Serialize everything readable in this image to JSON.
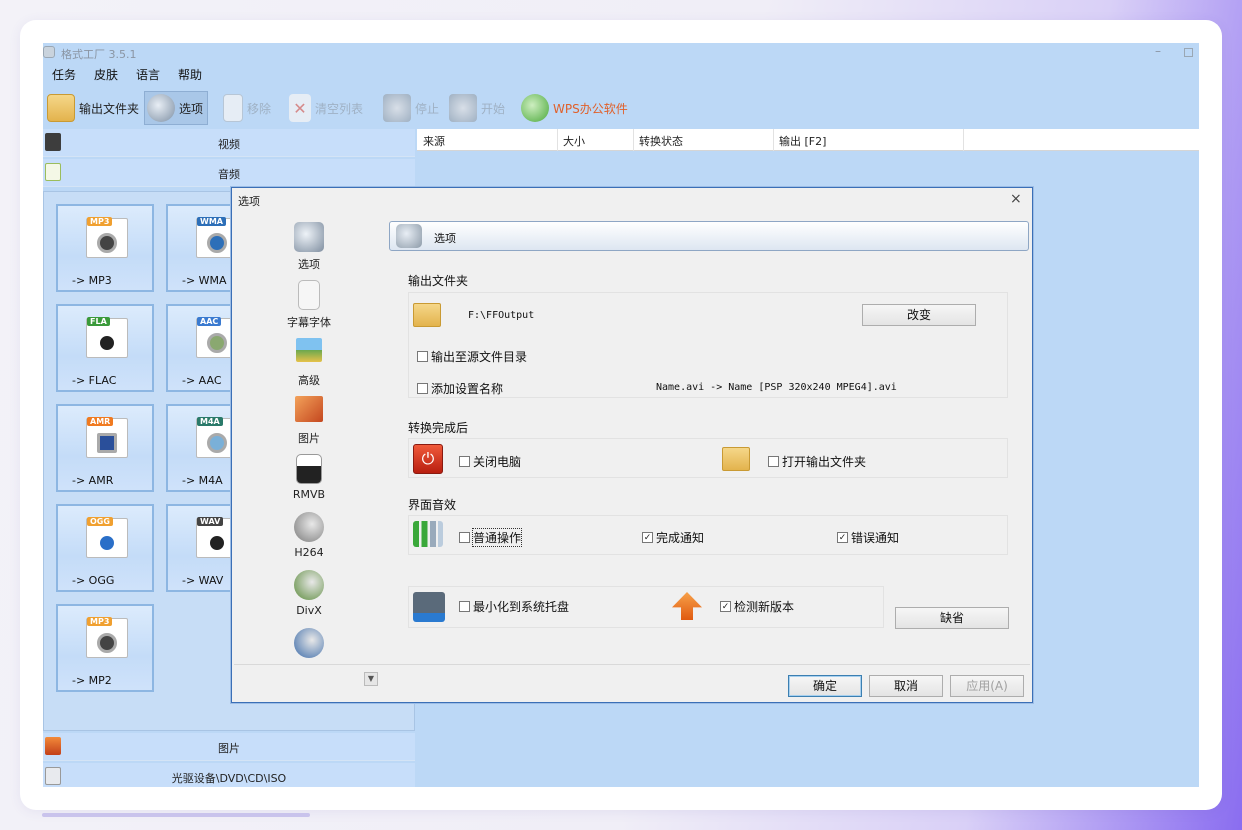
{
  "app": {
    "title": "格式工厂 3.5.1",
    "win_min": "–"
  },
  "menu": [
    "任务",
    "皮肤",
    "语言",
    "帮助"
  ],
  "toolbar": {
    "output_folder": "输出文件夹",
    "options": "选项",
    "remove": "移除",
    "clear_list": "清空列表",
    "stop": "停止",
    "start": "开始",
    "wps": "WPS办公软件"
  },
  "sidebar": {
    "categories": {
      "video": "视频",
      "audio": "音频",
      "picture": "图片",
      "rom": "光驱设备\\DVD\\CD\\ISO"
    },
    "tiles": [
      {
        "tag": "MP3",
        "caption": "-> MP3",
        "color": "#f0a030"
      },
      {
        "tag": "WMA",
        "caption": "-> WMA",
        "color": "#2d6fb8"
      },
      {
        "tag": "FLA",
        "caption": "-> FLAC",
        "color": "#3a9a3a"
      },
      {
        "tag": "AAC",
        "caption": "-> AAC",
        "color": "#3a7ad0"
      },
      {
        "tag": "AMR",
        "caption": "-> AMR",
        "color": "#f07a20"
      },
      {
        "tag": "M4A",
        "caption": "-> M4A",
        "color": "#2a7a6a"
      },
      {
        "tag": "OGG",
        "caption": "-> OGG",
        "color": "#f0a030"
      },
      {
        "tag": "WAV",
        "caption": "-> WAV",
        "color": "#444444"
      },
      {
        "tag": "MP3",
        "caption": "-> MP2",
        "color": "#f0a030"
      }
    ]
  },
  "filelist": {
    "columns": [
      "来源",
      "大小",
      "转换状态",
      "输出 [F2]"
    ]
  },
  "dialog": {
    "title": "选项",
    "close": "×",
    "nav": [
      "选项",
      "字幕字体",
      "高级",
      "图片",
      "RMVB",
      "H264",
      "DivX",
      ""
    ],
    "nav_scroll": "▼",
    "header": "选项",
    "output_folder_section": "输出文件夹",
    "output_path": "F:\\FFOutput",
    "change_button": "改变",
    "output_to_source": "输出至源文件目录",
    "add_setting_name": "添加设置名称",
    "name_example": "Name.avi  -> Name [PSP 320x240 MPEG4].avi",
    "after_convert_section": "转换完成后",
    "shutdown": "关闭电脑",
    "open_output_folder": "打开输出文件夹",
    "ui_sound_section": "界面音效",
    "normal_op": "普通操作",
    "complete_notify": "完成通知",
    "error_notify": "错误通知",
    "minimize_tray": "最小化到系统托盘",
    "check_update": "检测新版本",
    "default_button": "缺省",
    "ok": "确定",
    "cancel": "取消",
    "apply": "应用(A)",
    "checked_mark": "✓"
  }
}
